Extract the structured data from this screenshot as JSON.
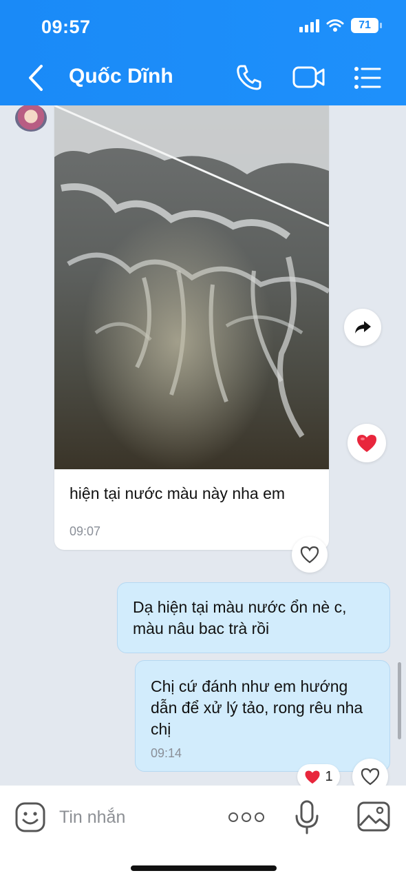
{
  "status_bar": {
    "time": "09:57",
    "battery": "71"
  },
  "header": {
    "contact_name": "Quốc Dĩnh"
  },
  "messages": [
    {
      "type": "photo",
      "direction": "incoming",
      "caption": "hiện tại nước màu này nha em",
      "time": "09:07"
    },
    {
      "type": "text",
      "direction": "outgoing",
      "text": "Dạ hiện tại màu nước ổn nè c, màu nâu bac trà rồi"
    },
    {
      "type": "text",
      "direction": "outgoing",
      "text": "Chị cứ đánh như em hướng dẫn để xử lý tảo, rong rêu nha chị",
      "time": "09:14",
      "reaction_count": "1"
    }
  ],
  "input": {
    "placeholder": "Tin nhắn"
  },
  "colors": {
    "header": "#1a8af7",
    "outgoing_bubble": "#d2ecfc",
    "background": "#e3e8ef",
    "reaction": "#e8263c"
  },
  "icons": [
    "back-arrow-icon",
    "phone-icon",
    "video-camera-icon",
    "list-menu-icon",
    "forward-icon",
    "heart-icon",
    "sticker-icon",
    "more-icon",
    "microphone-icon",
    "image-icon"
  ]
}
